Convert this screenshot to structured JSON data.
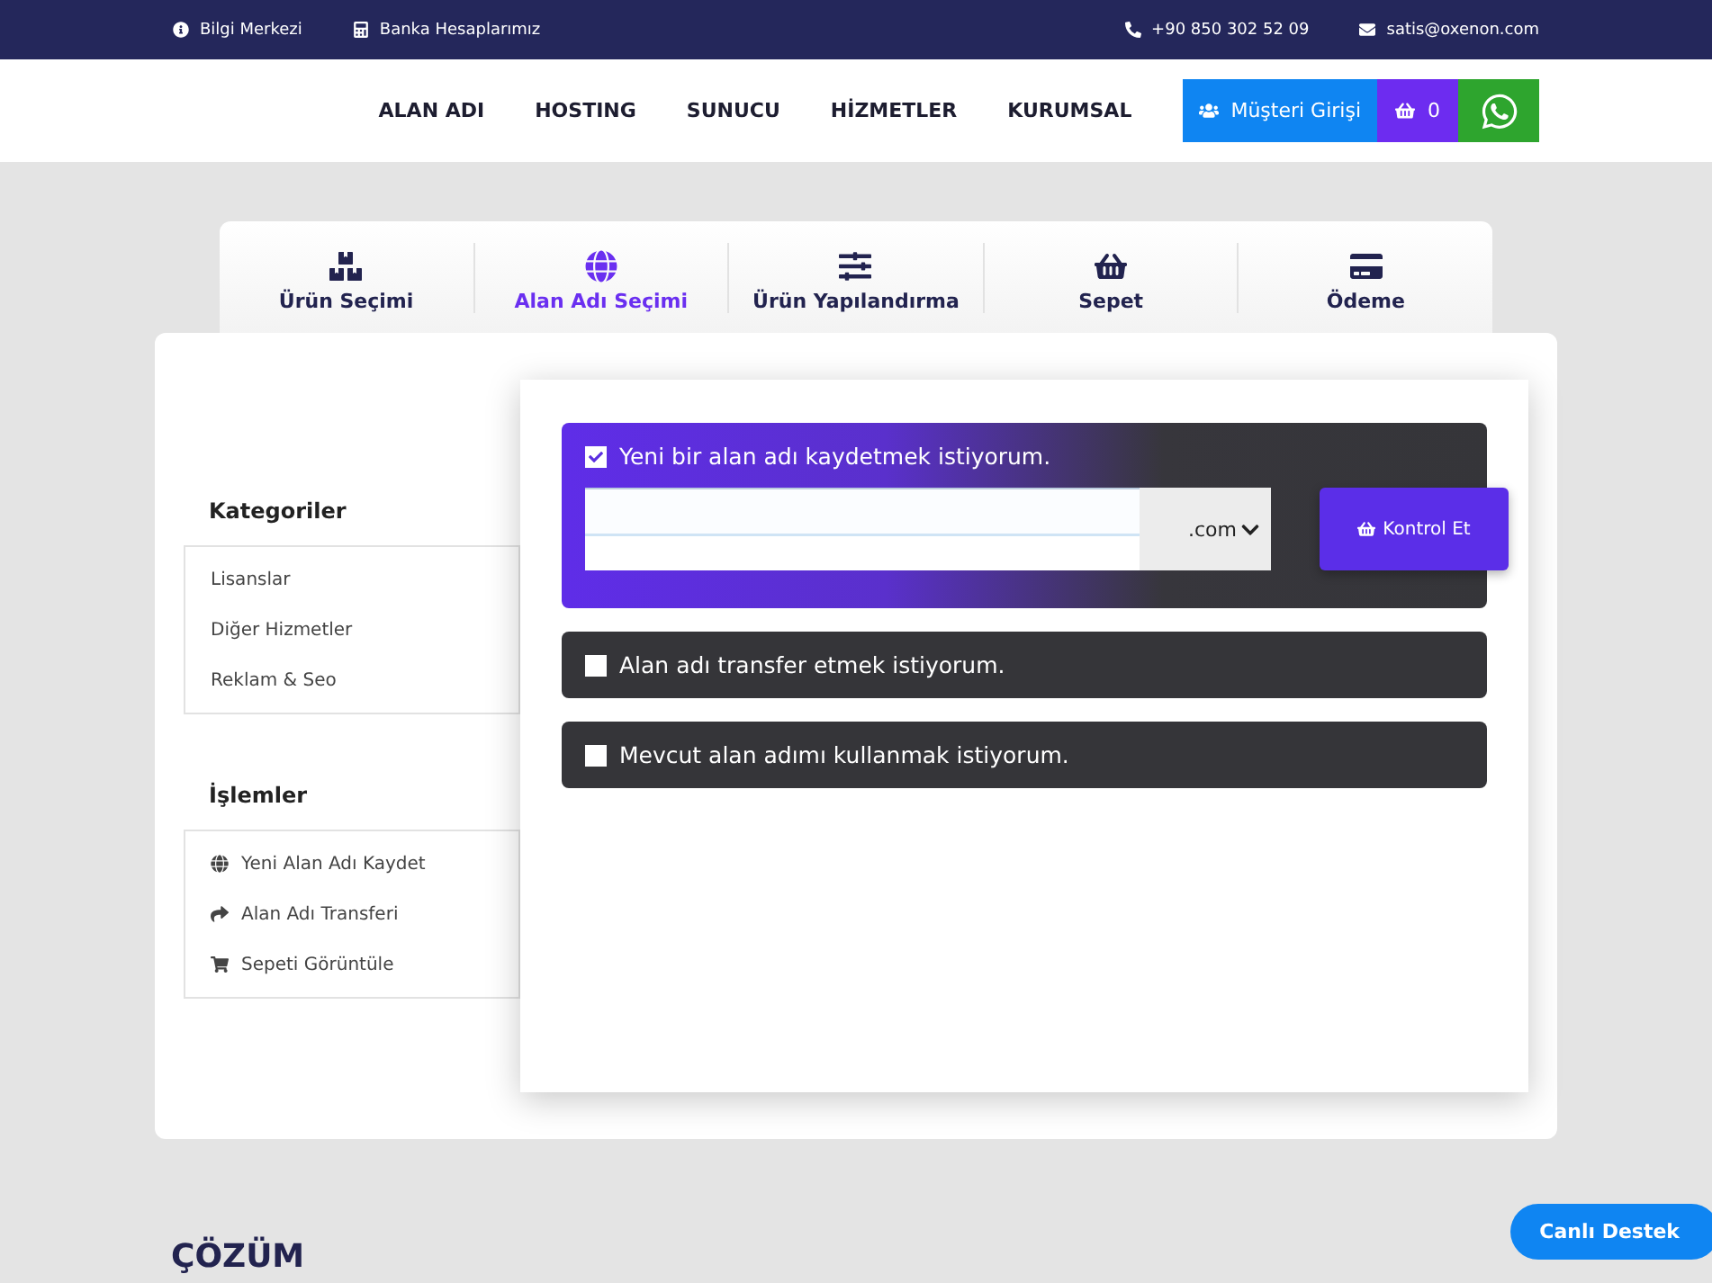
{
  "topbar": {
    "left": [
      {
        "kind": "info",
        "label": "Bilgi Merkezi"
      },
      {
        "kind": "calculator",
        "label": "Banka Hesaplarımız"
      }
    ],
    "right": [
      {
        "kind": "phone",
        "label": "+90 850 302 52 09"
      },
      {
        "kind": "mail",
        "label": "satis@oxenon.com"
      }
    ]
  },
  "nav": {
    "items": [
      "ALAN ADI",
      "HOSTING",
      "SUNUCU",
      "HİZMETLER",
      "KURUMSAL"
    ],
    "login": "Müşteri Girişi",
    "cart_count": "0"
  },
  "steps": [
    {
      "kind": "boxes",
      "label": "Ürün Seçimi",
      "selected": false
    },
    {
      "kind": "globe",
      "label": "Alan Adı Seçimi",
      "selected": true
    },
    {
      "kind": "sliders",
      "label": "Ürün Yapılandırma",
      "selected": false
    },
    {
      "kind": "basket",
      "label": "Sepet",
      "selected": false
    },
    {
      "kind": "card",
      "label": "Ödeme",
      "selected": false
    }
  ],
  "sidebar": {
    "categories_title": "Kategoriler",
    "categories": [
      "Lisanslar",
      "Diğer Hizmetler",
      "Reklam & Seo"
    ],
    "actions_title": "İşlemler",
    "actions": [
      {
        "kind": "globe",
        "label": "Yeni Alan Adı Kaydet"
      },
      {
        "kind": "share",
        "label": "Alan Adı Transferi"
      },
      {
        "kind": "cart",
        "label": "Sepeti Görüntüle"
      }
    ]
  },
  "options": [
    {
      "label": "Yeni bir alan adı kaydetmek istiyorum.",
      "checked": true,
      "tld": ".com",
      "button": "Kontrol Et"
    },
    {
      "label": "Alan adı transfer etmek istiyorum.",
      "checked": false
    },
    {
      "label": "Mevcut alan adımı kullanmak istiyorum.",
      "checked": false
    }
  ],
  "live_support": "Canlı Destek",
  "footer_heading": "ÇÖZÜM"
}
